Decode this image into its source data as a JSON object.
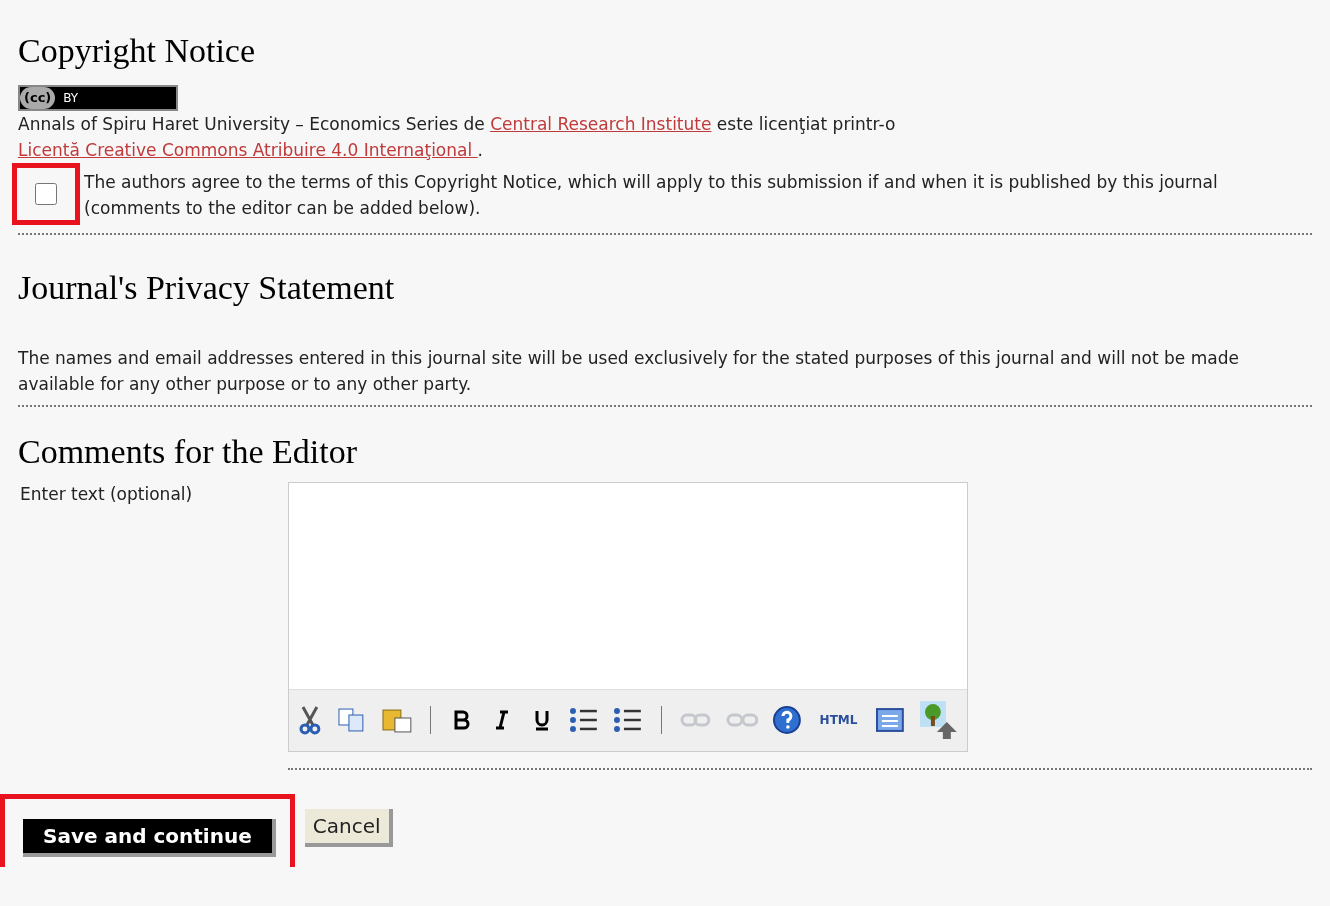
{
  "copyright": {
    "title": "Copyright Notice",
    "badge": {
      "symbol": "(cc)",
      "label": "BY"
    },
    "license_text": [
      "Annals of Spiru Haret University – Economics Series de ",
      {
        "link": "Central Research Institute"
      },
      " este licenţiat printr-o ",
      {
        "link": "Licentă Creative Commons Atribuire 4.0 Internaţional "
      },
      "."
    ],
    "agree": {
      "checked": false,
      "highlighted": true,
      "label": "The authors agree to the terms of this Copyright Notice, which will apply to this submission if and when it is published by this journal (comments to the editor can be added below)."
    }
  },
  "privacy": {
    "title": "Journal's Privacy Statement",
    "text": "The names and email addresses entered in this journal site will be used exclusively for the stated purposes of this journal and will not be made available for any other purpose or to any other party."
  },
  "comments": {
    "title": "Comments for the Editor",
    "label": "Enter text (optional)",
    "toolbar": [
      {
        "kind": "cut",
        "disabled": false
      },
      {
        "kind": "copy",
        "disabled": false
      },
      {
        "kind": "paste",
        "disabled": false
      },
      {
        "kind": "separator"
      },
      {
        "kind": "bold",
        "disabled": false
      },
      {
        "kind": "italic",
        "disabled": false
      },
      {
        "kind": "underline",
        "disabled": false
      },
      {
        "kind": "bullets",
        "disabled": false
      },
      {
        "kind": "numbers",
        "disabled": false
      },
      {
        "kind": "separator"
      },
      {
        "kind": "link",
        "disabled": true
      },
      {
        "kind": "unlink",
        "disabled": true
      },
      {
        "kind": "help",
        "disabled": false
      },
      {
        "kind": "html",
        "label": "HTML",
        "disabled": false
      },
      {
        "kind": "fullscreen",
        "disabled": false
      },
      {
        "kind": "image",
        "disabled": false
      }
    ]
  },
  "buttons": [
    {
      "label": "Save and continue",
      "primary": true,
      "highlighted": true
    },
    {
      "label": "Cancel",
      "primary": false,
      "highlighted": false
    }
  ]
}
